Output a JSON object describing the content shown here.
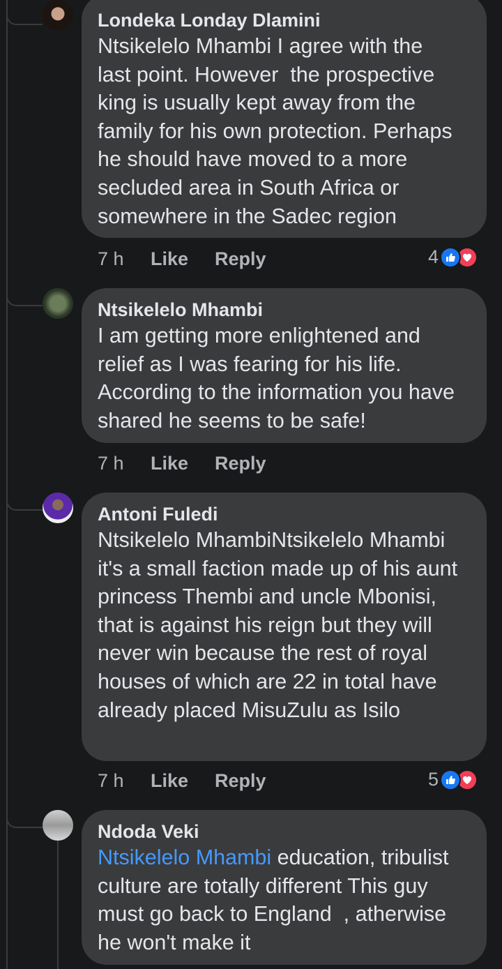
{
  "comments": [
    {
      "author": "Londeka Londay Dlamini",
      "text": "Ntsikelelo Mhambi I agree with the last point. However  the prospective king is usually kept away from the family for his own protection. Perhaps he should have moved to a more secluded area in South Africa or somewhere in the Sadec region",
      "time": "7 h",
      "like_label": "Like",
      "reply_label": "Reply",
      "reaction_count": "4"
    },
    {
      "author": "Ntsikelelo Mhambi",
      "text": "I am getting more enlightened and relief as I was fearing for his life. According to the information you have shared he seems to be safe!",
      "time": "7 h",
      "like_label": "Like",
      "reply_label": "Reply"
    },
    {
      "author": "Antoni Fuledi",
      "text": "Ntsikelelo MhambiNtsikelelo Mhambi it's a small faction made up of his aunt princess Thembi and uncle Mbonisi, that is against his reign but they will never win because the rest of royal houses of which are 22 in total have already placed MisuZulu as Isilo",
      "time": "7 h",
      "like_label": "Like",
      "reply_label": "Reply",
      "reaction_count": "5"
    },
    {
      "author": "Ndoda Veki",
      "mention": "Ntsikelelo Mhambi",
      "text": " education, tribulist  culture are totally different This guy must go back to England  , atherwise he won't make it"
    }
  ],
  "colors": {
    "background": "#18191a",
    "bubble": "#3a3b3c",
    "mention": "#4599ff",
    "like_reaction": "#1877f2",
    "love_reaction": "#f33e58"
  },
  "icons": [
    "like-reaction-icon",
    "love-reaction-icon"
  ]
}
